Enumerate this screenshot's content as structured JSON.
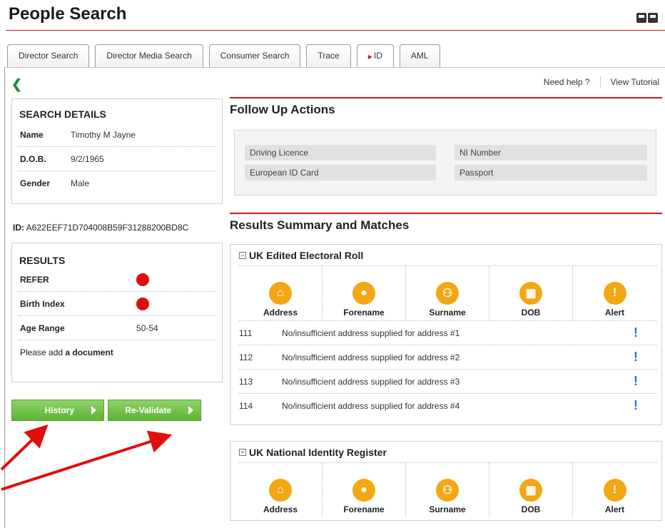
{
  "header": {
    "title": "People Search"
  },
  "tabs": [
    {
      "label": "Director Search"
    },
    {
      "label": "Director Media Search"
    },
    {
      "label": "Consumer Search"
    },
    {
      "label": "Trace"
    },
    {
      "label": "ID",
      "active": true
    },
    {
      "label": "AML"
    }
  ],
  "help": {
    "need_help": "Need help ?",
    "view_tutorial": "View Tutorial"
  },
  "search_details": {
    "title": "SEARCH DETAILS",
    "rows": [
      {
        "label": "Name",
        "value": "Timothy M Jayne"
      },
      {
        "label": "D.O.B.",
        "value": "9/2/1965"
      },
      {
        "label": "Gender",
        "value": "Male"
      }
    ]
  },
  "id_line": {
    "label": "ID:",
    "value": "A622EEF71D704008B59F31288200BD8C"
  },
  "results": {
    "title": "RESULTS",
    "rows": [
      {
        "label": "REFER",
        "status": "red"
      },
      {
        "label": "Birth Index",
        "status": "red"
      },
      {
        "label": "Age Range",
        "value": "50-54"
      }
    ],
    "note_prefix": "Please add ",
    "note_bold": "a document"
  },
  "buttons": {
    "history": "History",
    "revalidate": "Re-Validate"
  },
  "follow_up": {
    "title": "Follow Up Actions",
    "items": [
      "Driving Licence",
      "NI Number",
      "European ID Card",
      "Passport"
    ]
  },
  "results_summary": {
    "title": "Results Summary and Matches"
  },
  "electoral_roll": {
    "title": "UK Edited Electoral Roll",
    "toggle": "−",
    "icons": [
      {
        "label": "Address",
        "icon": "home-icon"
      },
      {
        "label": "Forename",
        "icon": "person-icon"
      },
      {
        "label": "Surname",
        "icon": "family-icon"
      },
      {
        "label": "DOB",
        "icon": "cake-icon"
      },
      {
        "label": "Alert",
        "icon": "alert-icon"
      }
    ],
    "rows": [
      {
        "code": "111",
        "message": "No/insufficient address supplied for address #1"
      },
      {
        "code": "112",
        "message": "No/insufficient address supplied for address #2"
      },
      {
        "code": "113",
        "message": "No/insufficient address supplied for address #3"
      },
      {
        "code": "114",
        "message": "No/insufficient address supplied for address #4"
      }
    ]
  },
  "national_register": {
    "title": "UK National Identity Register",
    "toggle": "+",
    "icons": [
      {
        "label": "Address",
        "icon": "home-icon"
      },
      {
        "label": "Forename",
        "icon": "person-icon"
      },
      {
        "label": "Surname",
        "icon": "family-icon"
      },
      {
        "label": "DOB",
        "icon": "cake-icon"
      },
      {
        "label": "Alert",
        "icon": "alert-icon"
      }
    ]
  },
  "colors": {
    "accent_red": "#c91c1c",
    "button_green": "#5db333",
    "icon_orange": "#f3a712",
    "status_red": "#e10e0e",
    "alert_blue": "#1e78d0"
  }
}
